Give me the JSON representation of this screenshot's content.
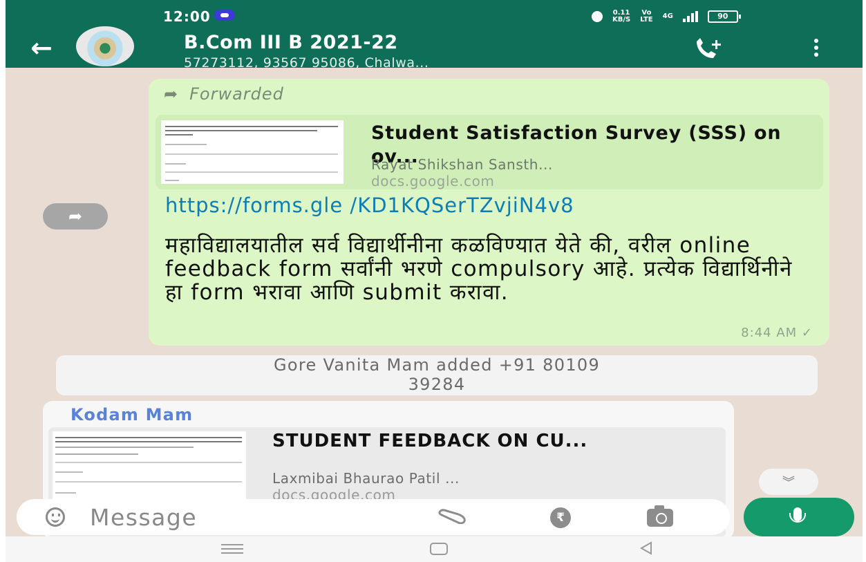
{
  "status_bar": {
    "time": "12:00",
    "net_speed": "0.11\nKB/S",
    "volte": "Vo\nLTE",
    "network": "4G",
    "battery": "90"
  },
  "header": {
    "title": "B.Com III B 2021-22",
    "members": "57273112, 93567 95086, Chalwa..."
  },
  "messages": {
    "outgoing": {
      "forwarded_label": "Forwarded",
      "preview": {
        "title": "Student Satisfaction Survey (SSS) on ov...",
        "site": "Rayat Shikshan Sansth...",
        "domain": "docs.google.com"
      },
      "link": "https://forms.gle /KD1KQSerTZvjiN4v8",
      "body": "महाविद्यालयातील सर्व विद्यार्थीनीना कळविण्यात येते की, वरील online feedback form सर्वांनी भरणे compulsory आहे. प्रत्येक विद्यार्थिनीने हा form भरावा आणि submit करावा.",
      "time": "8:44 AM",
      "status_tick": "✓"
    },
    "system": {
      "line1": "Gore Vanita Mam added +91 80109",
      "line2": "39284"
    },
    "incoming": {
      "sender": "Kodam Mam",
      "preview": {
        "title": "STUDENT FEEDBACK ON CU...",
        "site": "Laxmibai Bhaurao Patil ...",
        "domain": "docs.google.com"
      }
    }
  },
  "composer": {
    "placeholder": "Message",
    "rupee_symbol": "₹"
  },
  "icons": {
    "forward": "➦",
    "scroll_down": "︾",
    "back": "←"
  },
  "colors": {
    "app_bar": "#0f6e57",
    "outgoing_bubble": "#dcf6c5",
    "link": "#0d7db7",
    "sender_name": "#5a82d6",
    "mic_button": "#159a6b"
  }
}
